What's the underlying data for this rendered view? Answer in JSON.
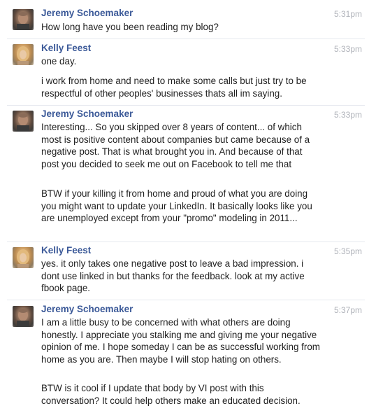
{
  "messages": [
    {
      "sender": "Jeremy Schoemaker",
      "time": "5:31pm",
      "paragraphs": [
        "How long have you been reading my blog?"
      ]
    },
    {
      "sender": "Kelly Feest",
      "time": "5:33pm",
      "paragraphs": [
        "one day.",
        "i work from home and need to make some calls but just try to be respectful of other peoples' businesses thats all im saying."
      ]
    },
    {
      "sender": "Jeremy Schoemaker",
      "time": "5:33pm",
      "paragraphs": [
        "Interesting... So you skipped over 8 years of content... of which most is positive content about companies but came because of a negative post. That is what brought you in. And because of that post you decided to seek me out on Facebook to tell me that",
        "BTW if your killing it from home and proud of what you are doing you might want to update your LinkedIn. It basically looks like you are unemployed except from your \"promo\" modeling in 2011..."
      ]
    },
    {
      "sender": "Kelly Feest",
      "time": "5:35pm",
      "paragraphs": [
        "yes. it only takes one negative post to leave a bad impression. i dont use linked in but thanks for the feedback. look at my active fbook page."
      ]
    },
    {
      "sender": "Jeremy Schoemaker",
      "time": "5:37pm",
      "paragraphs": [
        "I am a little busy to be concerned with what others are doing honestly. I appreciate you stalking me and giving me your negative opinion of me. I hope someday I can be as successful working from home as you are. Then maybe I will stop hating on others.",
        "BTW is it cool if I update that body by VI post with this conversation? It could help others make an educated decision."
      ]
    }
  ]
}
